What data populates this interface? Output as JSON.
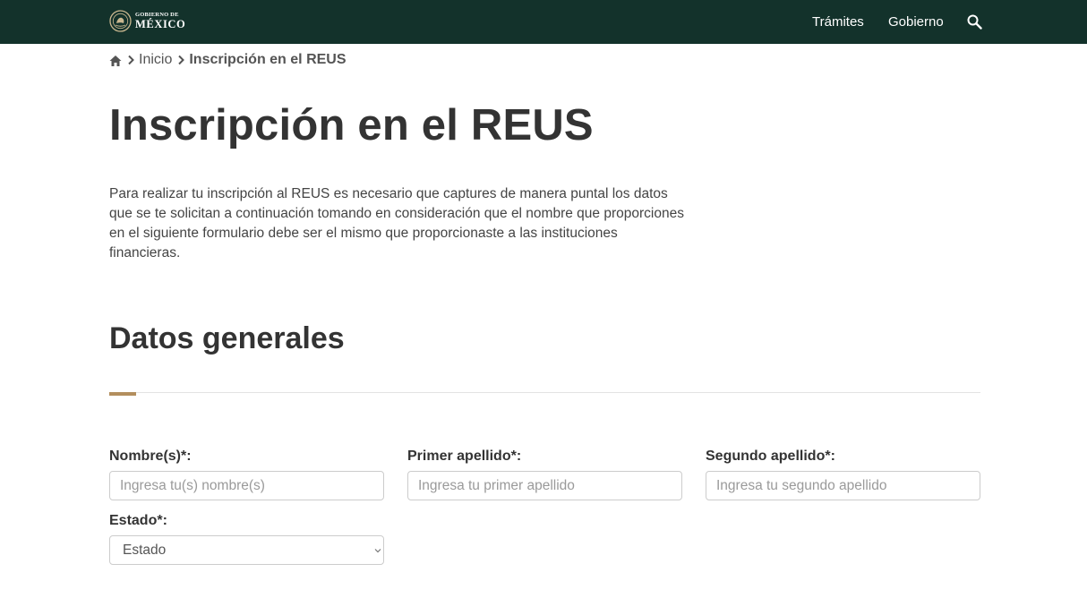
{
  "header": {
    "logo": {
      "line1": "GOBIERNO DE",
      "line2": "MÉXICO"
    },
    "nav": [
      {
        "label": "Trámites"
      },
      {
        "label": "Gobierno"
      }
    ],
    "search_icon": "search-icon",
    "background_color": "#13322b"
  },
  "breadcrumb": {
    "home_icon": "home-icon",
    "separator_icon": "chevron-right-icon",
    "items": [
      {
        "label": "Inicio"
      },
      {
        "label": "Inscripción en el REUS"
      }
    ]
  },
  "main": {
    "title": "Inscripción en el REUS",
    "intro": "Para realizar tu inscripción al REUS es necesario que captures de manera puntal los datos que se te solicitan a continuación tomando en consideración que el nombre que proporciones en el siguiente formulario debe ser el mismo que proporcionaste a las instituciones financieras.",
    "section_title": "Datos generales",
    "accent_color": "#b38e5d"
  },
  "form": {
    "nombre": {
      "label": "Nombre(s)*:",
      "placeholder": "Ingresa tu(s) nombre(s)",
      "value": ""
    },
    "primer_apellido": {
      "label": "Primer apellido*:",
      "placeholder": "Ingresa tu primer apellido",
      "value": ""
    },
    "segundo_apellido": {
      "label": "Segundo apellido*:",
      "placeholder": "Ingresa tu segundo apellido",
      "value": ""
    },
    "estado": {
      "label": "Estado*:",
      "selected": "Estado",
      "chevron_icon": "chevron-down-icon"
    }
  }
}
